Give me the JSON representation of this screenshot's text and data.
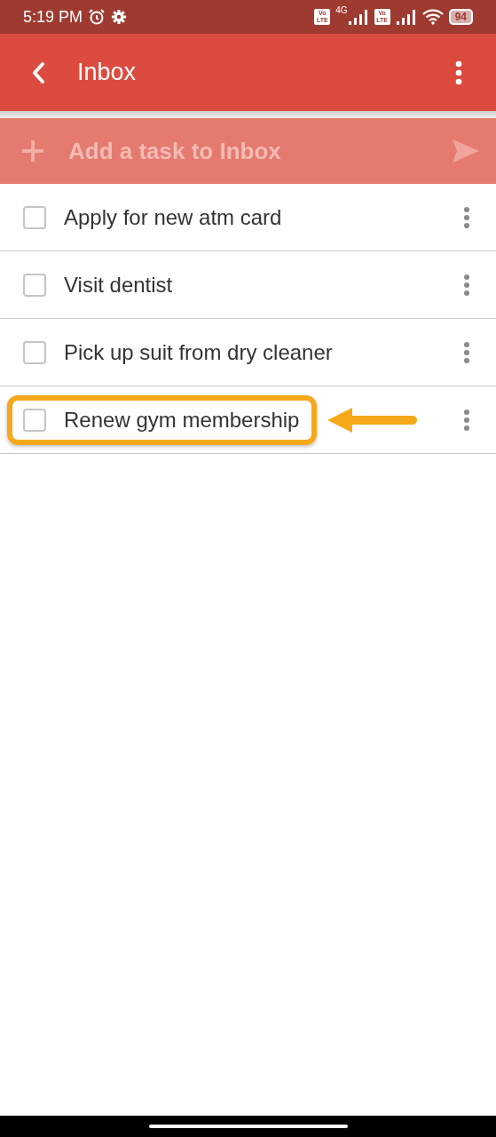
{
  "status_bar": {
    "time": "5:19 PM",
    "sims": [
      {
        "badge": "Vo LTE",
        "network": "4G"
      },
      {
        "badge": "Vo LTE"
      }
    ],
    "battery": "94"
  },
  "app_bar": {
    "title": "Inbox"
  },
  "add_task": {
    "placeholder": "Add a task to Inbox"
  },
  "tasks": [
    {
      "title": "Apply for new atm card",
      "checked": false,
      "highlighted": false
    },
    {
      "title": "Visit dentist",
      "checked": false,
      "highlighted": false
    },
    {
      "title": "Pick up suit from dry cleaner",
      "checked": false,
      "highlighted": false
    },
    {
      "title": "Renew gym membership",
      "checked": false,
      "highlighted": true
    }
  ]
}
